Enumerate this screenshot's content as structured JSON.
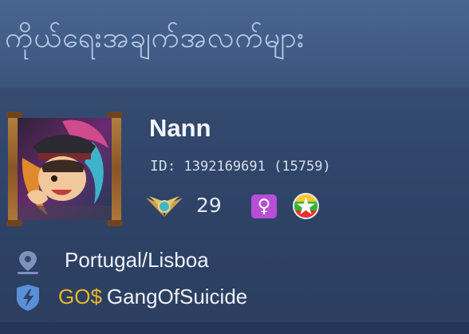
{
  "header": {
    "title": "ကိုယ်ရေးအချက်အလက်များ"
  },
  "profile": {
    "name": "Nann",
    "id_label": "ID:",
    "id_value": "1392169691 (15759)",
    "level": "29",
    "gender_symbol": "♀",
    "location": "Portugal/Lisboa",
    "squad_tag": "GO$",
    "squad_name": "GangOfSuicide"
  },
  "icons": {
    "avatar": "hero-avatar",
    "rank": "rank-wings-icon",
    "gender": "female-icon",
    "flag": "myanmar-flag-icon",
    "location": "location-pin-icon",
    "squad": "squad-shield-icon"
  },
  "colors": {
    "gender_badge": "#b64fd6",
    "squad_tag": "#e7b62c",
    "title_text": "#b9c8e4"
  }
}
